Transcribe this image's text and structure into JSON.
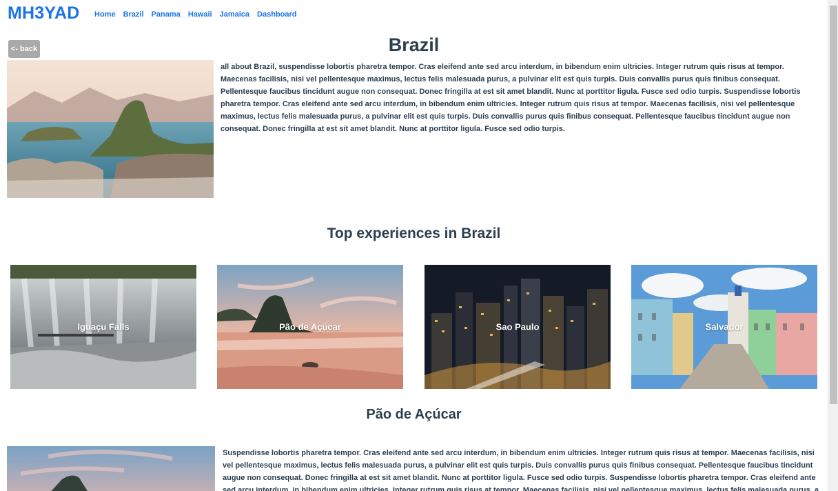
{
  "header": {
    "brand": "MH3YAD",
    "nav": [
      "Home",
      "Brazil",
      "Panama",
      "Hawaii",
      "Jamaica",
      "Dashboard"
    ]
  },
  "back_label": "<- back",
  "page_title": "Brazil",
  "intro": {
    "image_alt": "Rio de Janeiro aerial view",
    "text": "all about Brazil, suspendisse lobortis pharetra tempor. Cras eleifend ante sed arcu interdum, in bibendum enim ultricies. Integer rutrum quis risus at tempor. Maecenas facilisis, nisi vel pellentesque maximus, lectus felis malesuada purus, a pulvinar elit est quis turpis. Duis convallis purus quis finibus consequat. Pellentesque faucibus tincidunt augue non consequat. Donec fringilla at est sit amet blandit. Nunc at porttitor ligula. Fusce sed odio turpis. Suspendisse lobortis pharetra tempor. Cras eleifend ante sed arcu interdum, in bibendum enim ultricies. Integer rutrum quis risus at tempor. Maecenas facilisis, nisi vel pellentesque maximus, lectus felis malesuada purus, a pulvinar elit est quis turpis. Duis convallis purus quis finibus consequat. Pellentesque faucibus tincidunt augue non consequat. Donec fringilla at est sit amet blandit. Nunc at porttitor ligula. Fusce sed odio turpis."
  },
  "experiences": {
    "title": "Top experiences in Brazil",
    "cards": [
      {
        "label": "Iguaçu Falls"
      },
      {
        "label": "Pão de Açúcar"
      },
      {
        "label": "Sao Paulo"
      },
      {
        "label": "Salvador"
      }
    ]
  },
  "detail": {
    "title": "Pão de Açúcar",
    "text": "Suspendisse lobortis pharetra tempor. Cras eleifend ante sed arcu interdum, in bibendum enim ultricies. Integer rutrum quis risus at tempor. Maecenas facilisis, nisi vel pellentesque maximus, lectus felis malesuada purus, a pulvinar elit est quis turpis. Duis convallis purus quis finibus consequat. Pellentesque faucibus tincidunt augue non consequat. Donec fringilla at est sit amet blandit. Nunc at porttitor ligula. Fusce sed odio turpis. Suspendisse lobortis pharetra tempor. Cras eleifend ante sed arcu interdum, in bibendum enim ultricies. Integer rutrum quis risus at tempor. Maecenas facilisis, nisi vel pellentesque maximus, lectus felis malesuada purus, a pulvinar elit est quis turpis."
  },
  "colors": {
    "brand": "#1a73e8",
    "text": "#2c3e50",
    "back_button": "#a9a9a9"
  }
}
